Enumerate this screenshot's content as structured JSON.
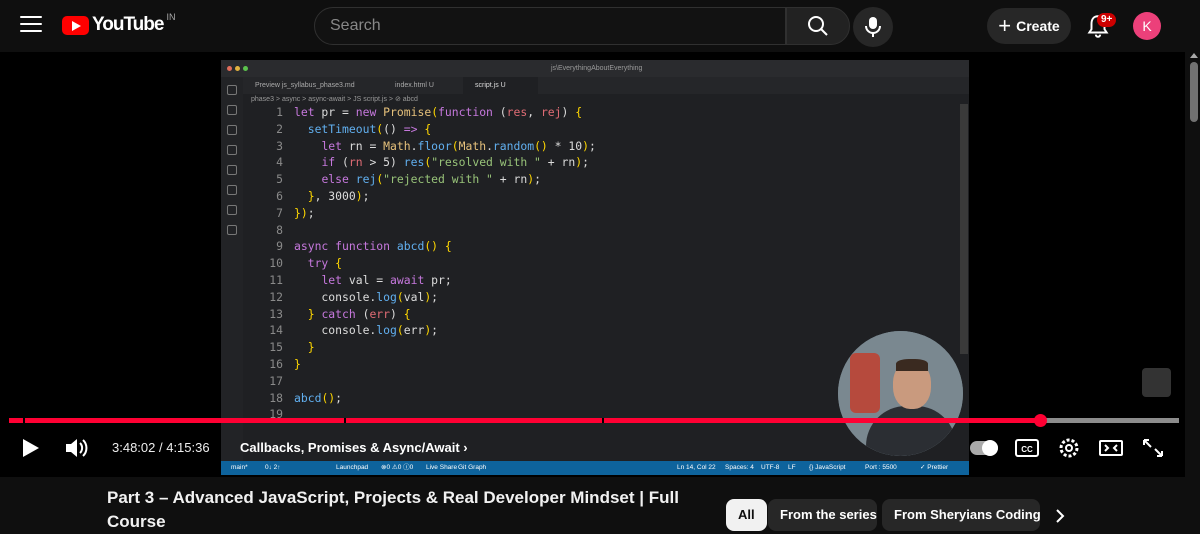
{
  "header": {
    "logo_text": "YouTube",
    "country_code": "IN",
    "search_placeholder": "Search",
    "create_label": "Create",
    "notification_count": "9+",
    "avatar_letter": "K"
  },
  "editor": {
    "window_path": "js\\EverythingAboutEverything",
    "tabs": [
      "Preview js_syllabus_phase3.md",
      "index.html U",
      "script.js U"
    ],
    "breadcrumb": "phase3 > async > async-await > JS script.js > ⊘ abcd",
    "status": {
      "branch": "main*",
      "sync": "0↓ 2↑",
      "launchpad": "Launchpad",
      "problems": "⊗0 ⚠0 ⓘ0",
      "live_share": "Live Share",
      "git_graph": "Git Graph",
      "position": "Ln 14, Col 22",
      "spaces": "Spaces: 4",
      "encoding": "UTF-8",
      "eol": "LF",
      "language": "{} JavaScript",
      "port": "Port : 5500",
      "prettier": "✓ Prettier"
    }
  },
  "code_lines": [
    {
      "n": "1",
      "tokens": [
        [
          "k",
          "let"
        ],
        [
          "t",
          " pr = "
        ],
        [
          "k",
          "new"
        ],
        [
          "t",
          " "
        ],
        [
          "n",
          "Promise"
        ],
        [
          "p",
          "("
        ],
        [
          "k",
          "function"
        ],
        [
          "t",
          " ("
        ],
        [
          "v",
          "res"
        ],
        [
          "t",
          ", "
        ],
        [
          "v",
          "rej"
        ],
        [
          "t",
          ") "
        ],
        [
          "p",
          "{"
        ]
      ]
    },
    {
      "n": "2",
      "tokens": [
        [
          "t",
          "  "
        ],
        [
          "f",
          "setTimeout"
        ],
        [
          "p",
          "("
        ],
        [
          "t",
          "() "
        ],
        [
          "k",
          "=>"
        ],
        [
          "t",
          " "
        ],
        [
          "p",
          "{"
        ]
      ]
    },
    {
      "n": "3",
      "tokens": [
        [
          "t",
          "    "
        ],
        [
          "k",
          "let"
        ],
        [
          "t",
          " rn = "
        ],
        [
          "n",
          "Math"
        ],
        [
          "t",
          "."
        ],
        [
          "f",
          "floor"
        ],
        [
          "p",
          "("
        ],
        [
          "n",
          "Math"
        ],
        [
          "t",
          "."
        ],
        [
          "f",
          "random"
        ],
        [
          "p",
          "()"
        ],
        [
          "t",
          " * 10"
        ],
        [
          "p",
          ")"
        ],
        [
          "t",
          ";"
        ]
      ]
    },
    {
      "n": "4",
      "tokens": [
        [
          "t",
          "    "
        ],
        [
          "k",
          "if"
        ],
        [
          "t",
          " ("
        ],
        [
          "v",
          "rn"
        ],
        [
          "t",
          " > 5) "
        ],
        [
          "f",
          "res"
        ],
        [
          "p",
          "("
        ],
        [
          "s",
          "\"resolved with \""
        ],
        [
          "t",
          " + rn"
        ],
        [
          "p",
          ")"
        ],
        [
          "t",
          ";"
        ]
      ]
    },
    {
      "n": "5",
      "tokens": [
        [
          "t",
          "    "
        ],
        [
          "k",
          "else"
        ],
        [
          "t",
          " "
        ],
        [
          "f",
          "rej"
        ],
        [
          "p",
          "("
        ],
        [
          "s",
          "\"rejected with \""
        ],
        [
          "t",
          " + rn"
        ],
        [
          "p",
          ")"
        ],
        [
          "t",
          ";"
        ]
      ]
    },
    {
      "n": "6",
      "tokens": [
        [
          "t",
          "  "
        ],
        [
          "p",
          "}"
        ],
        [
          "t",
          ", 3000"
        ],
        [
          "p",
          ")"
        ],
        [
          "t",
          ";"
        ]
      ]
    },
    {
      "n": "7",
      "tokens": [
        [
          "p",
          "})"
        ],
        [
          "t",
          ";"
        ]
      ]
    },
    {
      "n": "8",
      "tokens": []
    },
    {
      "n": "9",
      "tokens": [
        [
          "k",
          "async"
        ],
        [
          "t",
          " "
        ],
        [
          "k",
          "function"
        ],
        [
          "t",
          " "
        ],
        [
          "f",
          "abcd"
        ],
        [
          "p",
          "()"
        ],
        [
          "t",
          " "
        ],
        [
          "p",
          "{"
        ]
      ]
    },
    {
      "n": "10",
      "tokens": [
        [
          "t",
          "  "
        ],
        [
          "k",
          "try"
        ],
        [
          "t",
          " "
        ],
        [
          "p",
          "{"
        ]
      ]
    },
    {
      "n": "11",
      "tokens": [
        [
          "t",
          "    "
        ],
        [
          "k",
          "let"
        ],
        [
          "t",
          " val = "
        ],
        [
          "k",
          "await"
        ],
        [
          "t",
          " pr;"
        ]
      ]
    },
    {
      "n": "12",
      "tokens": [
        [
          "t",
          "    console."
        ],
        [
          "f",
          "log"
        ],
        [
          "p",
          "("
        ],
        [
          "t",
          "val"
        ],
        [
          "p",
          ")"
        ],
        [
          "t",
          ";"
        ]
      ]
    },
    {
      "n": "13",
      "tokens": [
        [
          "t",
          "  "
        ],
        [
          "p",
          "}"
        ],
        [
          "t",
          " "
        ],
        [
          "k",
          "catch"
        ],
        [
          "t",
          " ("
        ],
        [
          "v",
          "err"
        ],
        [
          "t",
          ") "
        ],
        [
          "p",
          "{"
        ]
      ]
    },
    {
      "n": "14",
      "tokens": [
        [
          "t",
          "    console."
        ],
        [
          "f",
          "log"
        ],
        [
          "p",
          "("
        ],
        [
          "t",
          "err"
        ],
        [
          "p",
          ")"
        ],
        [
          "t",
          ";"
        ]
      ]
    },
    {
      "n": "15",
      "tokens": [
        [
          "t",
          "  "
        ],
        [
          "p",
          "}"
        ]
      ]
    },
    {
      "n": "16",
      "tokens": [
        [
          "p",
          "}"
        ]
      ]
    },
    {
      "n": "17",
      "tokens": []
    },
    {
      "n": "18",
      "tokens": [
        [
          "f",
          "abcd"
        ],
        [
          "p",
          "()"
        ],
        [
          "t",
          ";"
        ]
      ]
    },
    {
      "n": "19",
      "tokens": []
    }
  ],
  "player": {
    "progress_fraction": 0.8811,
    "buffered_fraction": 1.0,
    "chapter_marks": [
      0.012,
      0.286,
      0.507
    ],
    "time_current": "3:48:02",
    "time_total": "4:15:36",
    "time_separator": " / ",
    "chapter_title": "Callbacks, Promises & Async/Await",
    "chapter_chevron": "›"
  },
  "video": {
    "title": "Part 3 – Advanced JavaScript, Projects & Real Developer Mindset | Full Course"
  },
  "chips": [
    {
      "label": "All",
      "selected": true
    },
    {
      "label": "From the series",
      "selected": false
    },
    {
      "label": "From Sheryians Coding S",
      "selected": false
    }
  ],
  "colors": {
    "accent_red": "#ff0033",
    "yt_red": "#ff0000",
    "avatar_pink": "#ec407a",
    "status_blue": "#0e639c"
  }
}
